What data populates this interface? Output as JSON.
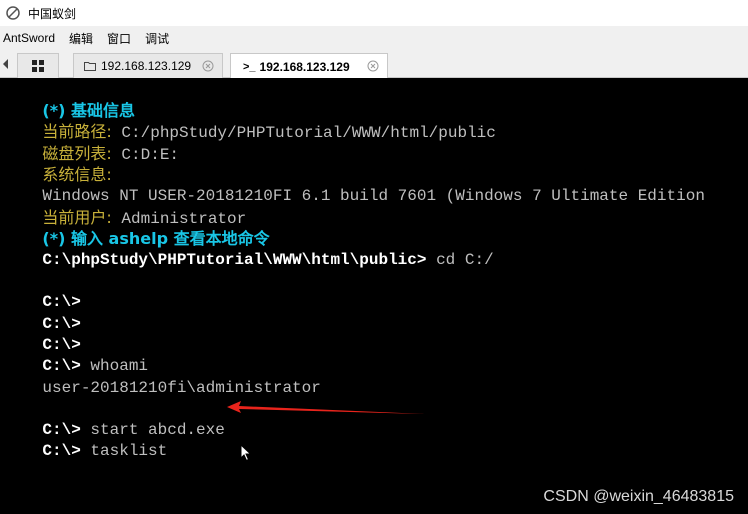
{
  "window": {
    "title": "中国蚁剑",
    "icon": "antsword-logo-icon"
  },
  "menubar": {
    "items": [
      "AntSword",
      "编辑",
      "窗口",
      "调试"
    ]
  },
  "tabs": {
    "grid_tab_icon": "grid-icon",
    "tab1": {
      "label": "192.168.123.129",
      "icon": "folder-icon"
    },
    "tab2": {
      "label": "192.168.123.129",
      "prefix": ">_",
      "active": true
    }
  },
  "terminal": {
    "lines": [
      {
        "label": "(*) 基础信息"
      },
      {
        "label": "当前路径:",
        "value": " C:/phpStudy/PHPTutorial/WWW/html/public"
      },
      {
        "label": "磁盘列表:",
        "value": " C:D:E:"
      },
      {
        "label": "系统信息:"
      },
      {
        "value": "Windows NT USER-20181210FI 6.1 build 7601 (Windows 7 Ultimate Edition"
      },
      {
        "label": "当前用户:",
        "value": " Administrator"
      },
      {
        "label": "(*) 输入 ashelp 查看本地命令"
      },
      {
        "prompt": "C:\\phpStudy\\PHPTutorial\\WWW\\html\\public>",
        "cmd": " cd C:/"
      },
      {
        "prompt": "C:\\>"
      },
      {
        "prompt": "C:\\>"
      },
      {
        "prompt": "C:\\>"
      },
      {
        "prompt": "C:\\>",
        "cmd": " whoami"
      },
      {
        "output": "user-20181210fi\\administrator"
      },
      {
        "prompt": "C:\\>",
        "cmd": " start abcd.exe"
      },
      {
        "prompt": "C:\\>",
        "cmd": " tasklist"
      }
    ]
  },
  "watermark": "CSDN @weixin_46483815",
  "colors": {
    "cyan": "#19c6e6",
    "yellow": "#c8b13a",
    "arrow": "#e8241c"
  }
}
